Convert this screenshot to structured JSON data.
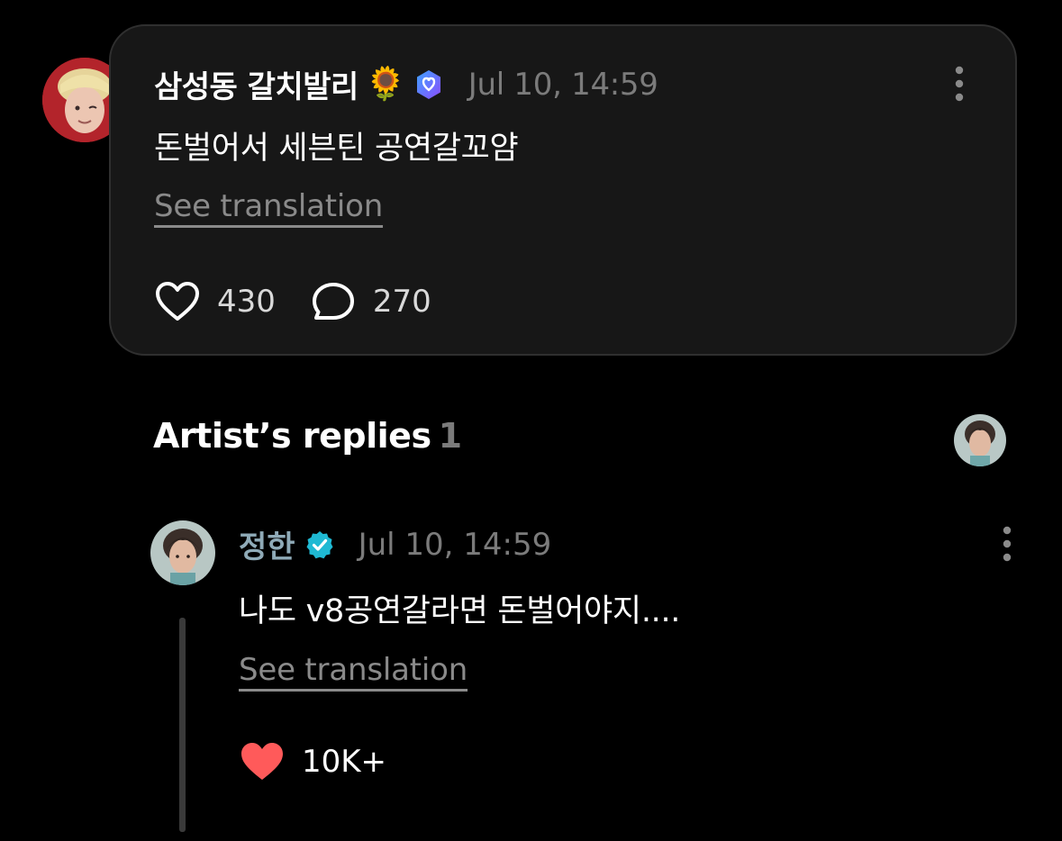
{
  "post": {
    "author": "삼성동 갈치발리",
    "author_emoji": "🌻",
    "timestamp": "Jul 10, 14:59",
    "body": "돈벌어서 세븐틴 공연갈꼬얌",
    "translate_label": "See translation",
    "like_count": "430",
    "comment_count": "270",
    "badge_color": "#6a5cff"
  },
  "artist_replies": {
    "title": "Artist’s replies",
    "count": "1"
  },
  "reply": {
    "author": "정한",
    "timestamp": "Jul 10, 14:59",
    "body": "나도 v8공연갈라면 돈벌어야지....",
    "translate_label": "See translation",
    "like_count": "10K+",
    "verified_color": "#1fb9d3",
    "like_color": "#ff5a5a"
  }
}
